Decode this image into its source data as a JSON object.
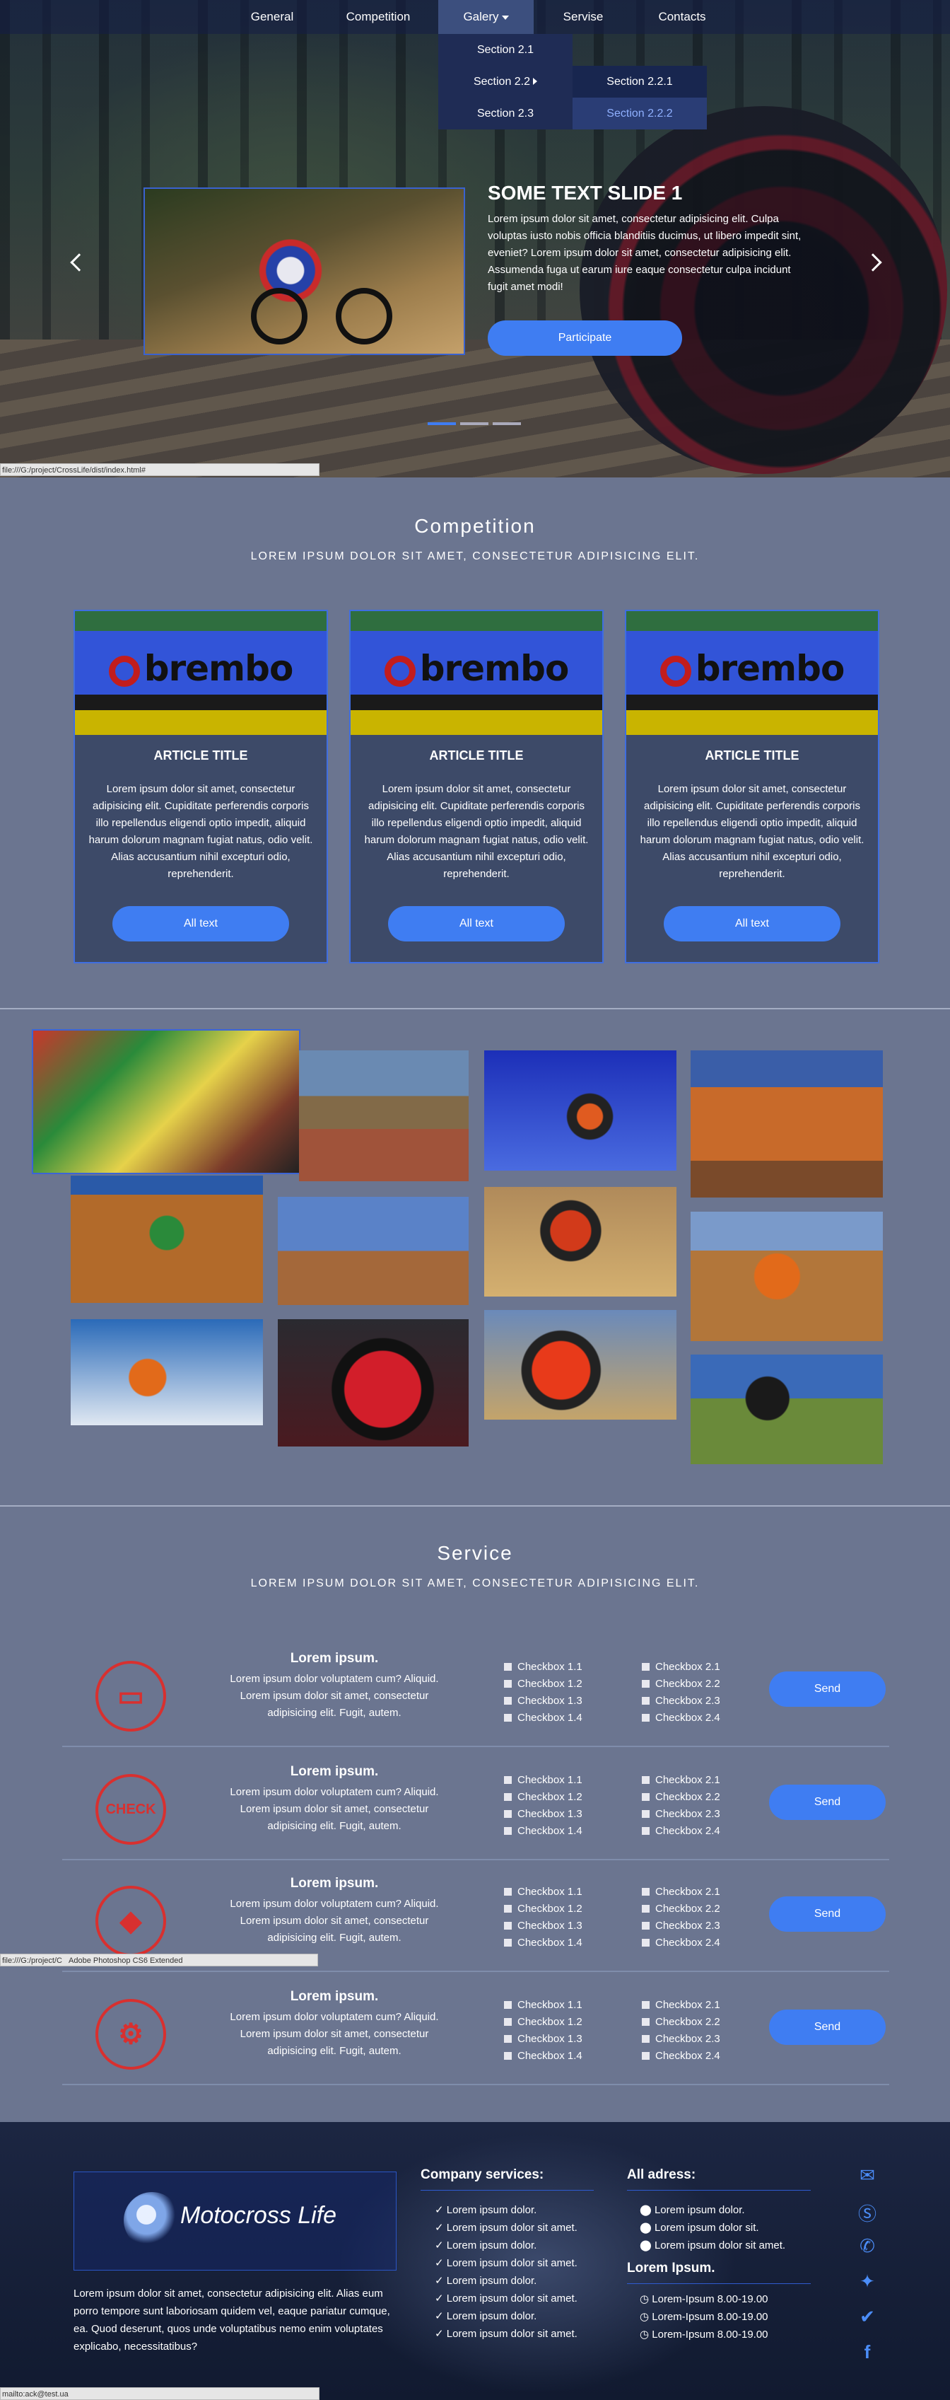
{
  "nav": {
    "items": [
      "General",
      "Competition",
      "Galery",
      "Servise",
      "Contacts"
    ],
    "dropdown": {
      "level1": [
        "Section 2.1",
        "Section 2.2",
        "Section 2.3"
      ],
      "level2": [
        "Section 2.2.1",
        "Section 2.2.2"
      ]
    }
  },
  "slider": {
    "title": "SOME TEXT SLIDE 1",
    "text": "Lorem ipsum dolor sit amet, consectetur adipisicing elit. Culpa voluptas iusto nobis officia blanditiis ducimus, ut libero impedit sint, eveniet? Lorem ipsum dolor sit amet, consectetur adipisicing elit. Assumenda fuga ut earum iure eaque consectetur culpa incidunt fugit amet modi!",
    "button": "Participate",
    "prev": "‹",
    "next": "›"
  },
  "status": {
    "url1": "file:///G:/project/CrossLife/dist/index.html#",
    "url2": "file:///G:/project/C",
    "app": "Adobe Photoshop CS6 Extended",
    "mail": "mailto:ack@test.ua"
  },
  "competition": {
    "title": "Competition",
    "subtitle": "LOREM IPSUM DOLOR SIT AMET, CONSECTETUR ADIPISICING ELIT.",
    "cards": [
      {
        "brand": "brembo",
        "title": "ARTICLE TITLE",
        "text": "Lorem ipsum dolor sit amet, consectetur adipisicing elit. Cupiditate perferendis corporis illo repellendus eligendi optio impedit, aliquid harum dolorum magnam fugiat natus, odio velit. Alias accusantium nihil excepturi odio, reprehenderit.",
        "button": "All text"
      },
      {
        "brand": "brembo",
        "title": "ARTICLE TITLE",
        "text": "Lorem ipsum dolor sit amet, consectetur adipisicing elit. Cupiditate perferendis corporis illo repellendus eligendi optio impedit, aliquid harum dolorum magnam fugiat natus, odio velit. Alias accusantium nihil excepturi odio, reprehenderit.",
        "button": "All text"
      },
      {
        "brand": "brembo",
        "title": "ARTICLE TITLE",
        "text": "Lorem ipsum dolor sit amet, consectetur adipisicing elit. Cupiditate perferendis corporis illo repellendus eligendi optio impedit, aliquid harum dolorum magnam fugiat natus, odio velit. Alias accusantium nihil excepturi odio, reprehenderit.",
        "button": "All text"
      }
    ]
  },
  "service": {
    "title": "Service",
    "subtitle": "LOREM IPSUM DOLOR SIT AMET, CONSECTETUR ADIPISICING ELIT.",
    "rows": [
      {
        "icon": "monitor-icon",
        "name": "Lorem ipsum.",
        "desc": "Lorem ipsum dolor voluptatem cum? Aliquid. Lorem ipsum dolor sit amet, consectetur adipisicing elit. Fugit, autem.",
        "col1": [
          "Checkbox 1.1",
          "Checkbox 1.2",
          "Checkbox 1.3",
          "Checkbox 1.4"
        ],
        "col2": [
          "Checkbox 2.1",
          "Checkbox 2.2",
          "Checkbox 2.3",
          "Checkbox 2.4"
        ],
        "button": "Send"
      },
      {
        "icon": "check-engine-icon",
        "name": "Lorem ipsum.",
        "desc": "Lorem ipsum dolor voluptatem cum? Aliquid. Lorem ipsum dolor sit amet, consectetur adipisicing elit. Fugit, autem.",
        "col1": [
          "Checkbox 1.1",
          "Checkbox 1.2",
          "Checkbox 1.3",
          "Checkbox 1.4"
        ],
        "col2": [
          "Checkbox 2.1",
          "Checkbox 2.2",
          "Checkbox 2.3",
          "Checkbox 2.4"
        ],
        "button": "Send",
        "icon_text": "CHECK"
      },
      {
        "icon": "oil-can-icon",
        "name": "Lorem ipsum.",
        "desc": "Lorem ipsum dolor voluptatem cum? Aliquid. Lorem ipsum dolor sit amet, consectetur adipisicing elit. Fugit, autem.",
        "col1": [
          "Checkbox 1.1",
          "Checkbox 1.2",
          "Checkbox 1.3",
          "Checkbox 1.4"
        ],
        "col2": [
          "Checkbox 2.1",
          "Checkbox 2.2",
          "Checkbox 2.3",
          "Checkbox 2.4"
        ],
        "button": "Send"
      },
      {
        "icon": "gearbox-icon",
        "name": "Lorem ipsum.",
        "desc": "Lorem ipsum dolor voluptatem cum? Aliquid. Lorem ipsum dolor sit amet, consectetur adipisicing elit. Fugit, autem.",
        "col1": [
          "Checkbox 1.1",
          "Checkbox 1.2",
          "Checkbox 1.3",
          "Checkbox 1.4"
        ],
        "col2": [
          "Checkbox 2.1",
          "Checkbox 2.2",
          "Checkbox 2.3",
          "Checkbox 2.4"
        ],
        "button": "Send"
      }
    ]
  },
  "footer": {
    "logo": "Motocross Life",
    "about": "Lorem ipsum dolor sit amet, consectetur adipisicing elit. Alias eum porro tempore sunt laboriosam quidem vel, eaque pariatur cumque, ea. Quod deserunt, quos unde voluptatibus nemo enim voluptates explicabo, necessitatibus?",
    "company_title": "Company services:",
    "company_items": [
      "Lorem ipsum dolor.",
      "Lorem ipsum dolor sit amet.",
      "Lorem ipsum dolor.",
      "Lorem ipsum dolor sit amet.",
      "Lorem ipsum dolor.",
      "Lorem ipsum dolor sit amet.",
      "Lorem ipsum dolor.",
      "Lorem ipsum dolor sit amet."
    ],
    "address_title": "All adress:",
    "address_items": [
      "Lorem ipsum dolor.",
      "Lorem ipsum dolor sit.",
      "Lorem ipsum dolor sit amet."
    ],
    "hours_title": "Lorem Ipsum.",
    "hours": [
      "Lorem-Ipsum 8.00-19.00",
      "Lorem-Ipsum 8.00-19.00",
      "Lorem-Ipsum 8.00-19.00"
    ],
    "social": [
      "mail-icon",
      "skype-icon",
      "phone-icon",
      "twitter-icon",
      "vk-icon",
      "facebook-icon"
    ]
  },
  "colors": {
    "accent": "#3f7df2",
    "service_icon": "#d8302f",
    "bg": "#6b7590"
  }
}
